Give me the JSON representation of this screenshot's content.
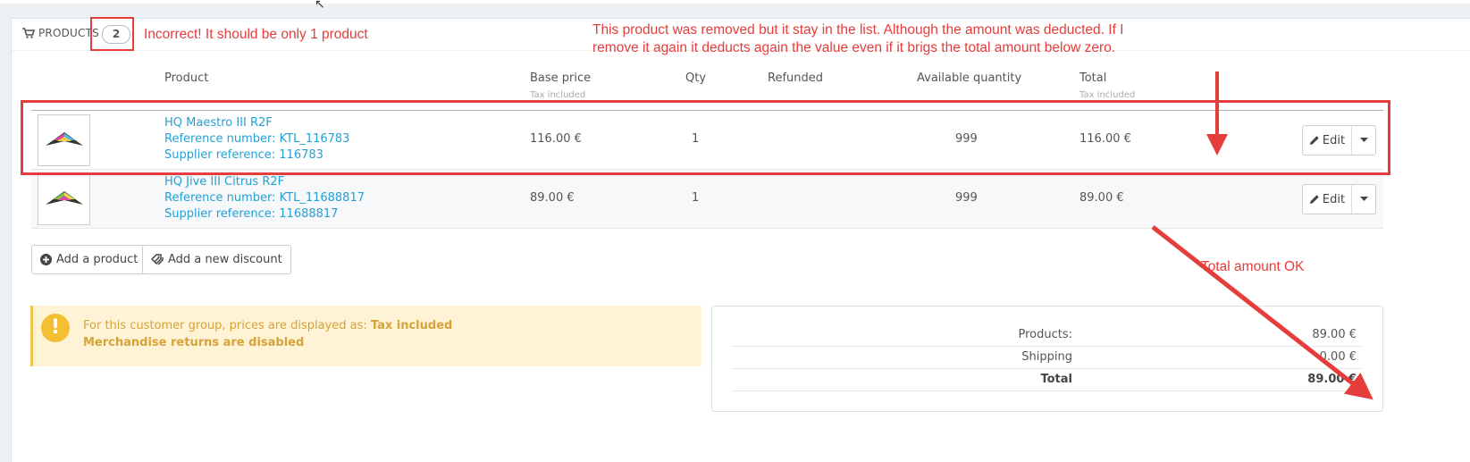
{
  "panel": {
    "heading": "PRODUCTS",
    "count": "2"
  },
  "annotations": {
    "count_note": "Incorrect! It should be only 1 product",
    "removed_note_line1": "This product was removed but it stay in the list. Although the amount was deducted. If I",
    "removed_note_line2": "remove it again it deducts again the value even if it brigs the total amount below zero.",
    "total_note": "Total amount OK",
    "color": "#e43d3b"
  },
  "columns": {
    "product": "Product",
    "base_price": "Base price",
    "base_price_sub": "Tax included",
    "qty": "Qty",
    "refunded": "Refunded",
    "available": "Available quantity",
    "total": "Total",
    "total_sub": "Tax included"
  },
  "rows": [
    {
      "name": "HQ Maestro III R2F",
      "reference": "Reference number: KTL_116783",
      "supplier": "Supplier reference: 116783",
      "base_price": "116.00 €",
      "qty": "1",
      "refunded": "",
      "available": "999",
      "total": "116.00 €",
      "edit_label": "Edit"
    },
    {
      "name": "HQ Jive III Citrus R2F",
      "reference": "Reference number: KTL_11688817",
      "supplier": "Supplier reference: 11688817",
      "base_price": "89.00 €",
      "qty": "1",
      "refunded": "",
      "available": "999",
      "total": "89.00 €",
      "edit_label": "Edit"
    }
  ],
  "actions": {
    "add_product": "Add a product",
    "add_discount": "Add a new discount"
  },
  "alert": {
    "prefix": "For this customer group, prices are displayed as: ",
    "tax_mode": "Tax included",
    "returns": "Merchandise returns are disabled"
  },
  "totals": {
    "products_label": "Products:",
    "products_value": "89.00 €",
    "shipping_label": "Shipping",
    "shipping_value": "0.00 €",
    "total_label": "Total",
    "total_value": "89.00 €"
  }
}
